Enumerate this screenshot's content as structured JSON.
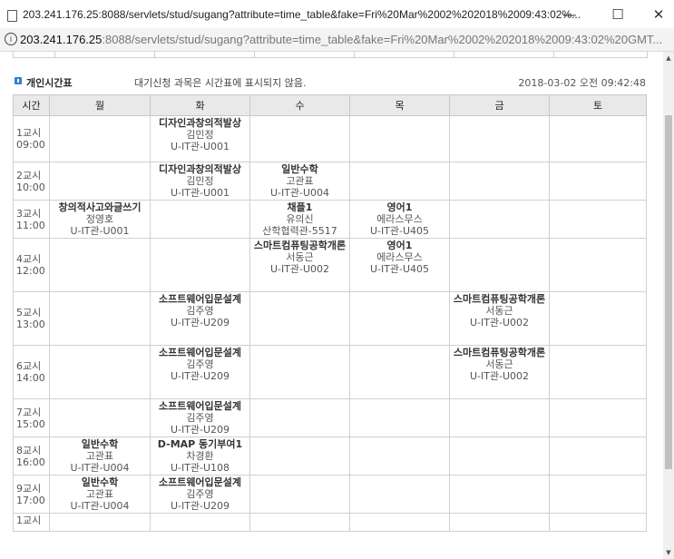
{
  "window": {
    "title": "203.241.176.25:8088/servlets/stud/sugang?attribute=time_table&fake=Fri%20Mar%2002%202018%2009:43:02%...",
    "controls": {
      "minimize": "—",
      "maximize": "☐",
      "close": "✕"
    }
  },
  "address_bar": {
    "host": "203.241.176.25",
    "path": ":8088/servlets/stud/sugang?attribute=time_table&fake=Fri%20Mar%2002%202018%2009:43:02%20GMT..."
  },
  "section": {
    "title": "개인시간표",
    "note": "대기신청 과목은 시간표에 표시되지 않음.",
    "timestamp": "2018-03-02 오전 09:42:48"
  },
  "table": {
    "headers": [
      "시간",
      "월",
      "화",
      "수",
      "목",
      "금",
      "토"
    ],
    "rows": [
      {
        "period": "1교시",
        "time": "09:00",
        "cells": [
          null,
          {
            "name": "디자인과창의적발상",
            "prof": "김민정",
            "room": "U-IT관-U001"
          },
          null,
          null,
          null,
          null
        ]
      },
      {
        "period": "2교시",
        "time": "10:00",
        "cells": [
          null,
          {
            "name": "디자인과창의적발상",
            "prof": "김민정",
            "room": "U-IT관-U001"
          },
          {
            "name": "일반수학",
            "prof": "고관표",
            "room": "U-IT관-U004"
          },
          null,
          null,
          null
        ]
      },
      {
        "period": "3교시",
        "time": "11:00",
        "cells": [
          {
            "name": "창의적사고와글쓰기",
            "prof": "정영호",
            "room": "U-IT관-U001"
          },
          null,
          {
            "name": "채플1",
            "prof": "유의신",
            "room": "산학협력관-5517"
          },
          {
            "name": "영어1",
            "prof": "에라스무스",
            "room": "U-IT관-U405"
          },
          null,
          null
        ]
      },
      {
        "period": "4교시",
        "time": "12:00",
        "cells": [
          null,
          null,
          {
            "name": "스마트컴퓨팅공학개론",
            "prof": "서동근",
            "room": "U-IT관-U002"
          },
          {
            "name": "영어1",
            "prof": "에라스무스",
            "room": "U-IT관-U405"
          },
          null,
          null
        ]
      },
      {
        "period": "5교시",
        "time": "13:00",
        "cells": [
          null,
          {
            "name": "소프트웨어입문설계",
            "prof": "김주영",
            "room": "U-IT관-U209"
          },
          null,
          null,
          {
            "name": "스마트컴퓨팅공학개론",
            "prof": "서동근",
            "room": "U-IT관-U002"
          },
          null
        ]
      },
      {
        "period": "6교시",
        "time": "14:00",
        "cells": [
          null,
          {
            "name": "소프트웨어입문설계",
            "prof": "김주영",
            "room": "U-IT관-U209"
          },
          null,
          null,
          {
            "name": "스마트컴퓨팅공학개론",
            "prof": "서동근",
            "room": "U-IT관-U002"
          },
          null
        ]
      },
      {
        "period": "7교시",
        "time": "15:00",
        "cells": [
          null,
          {
            "name": "소프트웨어입문설계",
            "prof": "김주영",
            "room": "U-IT관-U209"
          },
          null,
          null,
          null,
          null
        ]
      },
      {
        "period": "8교시",
        "time": "16:00",
        "cells": [
          {
            "name": "일반수학",
            "prof": "고관표",
            "room": "U-IT관-U004"
          },
          {
            "name": "D-MAP 동기부여1",
            "prof": "차경환",
            "room": "U-IT관-U108"
          },
          null,
          null,
          null,
          null
        ]
      },
      {
        "period": "9교시",
        "time": "17:00",
        "cells": [
          {
            "name": "일반수학",
            "prof": "고관표",
            "room": "U-IT관-U004"
          },
          {
            "name": "소프트웨어입문설계",
            "prof": "김주영",
            "room": "U-IT관-U209"
          },
          null,
          null,
          null,
          null
        ]
      },
      {
        "period": "1교시",
        "time": "",
        "cells": [
          null,
          null,
          null,
          null,
          null,
          null
        ]
      }
    ]
  },
  "colors": {
    "bullet": "#2f7fd6",
    "header_bg": "#e9e9e9",
    "grid": "#d0d0d0"
  }
}
